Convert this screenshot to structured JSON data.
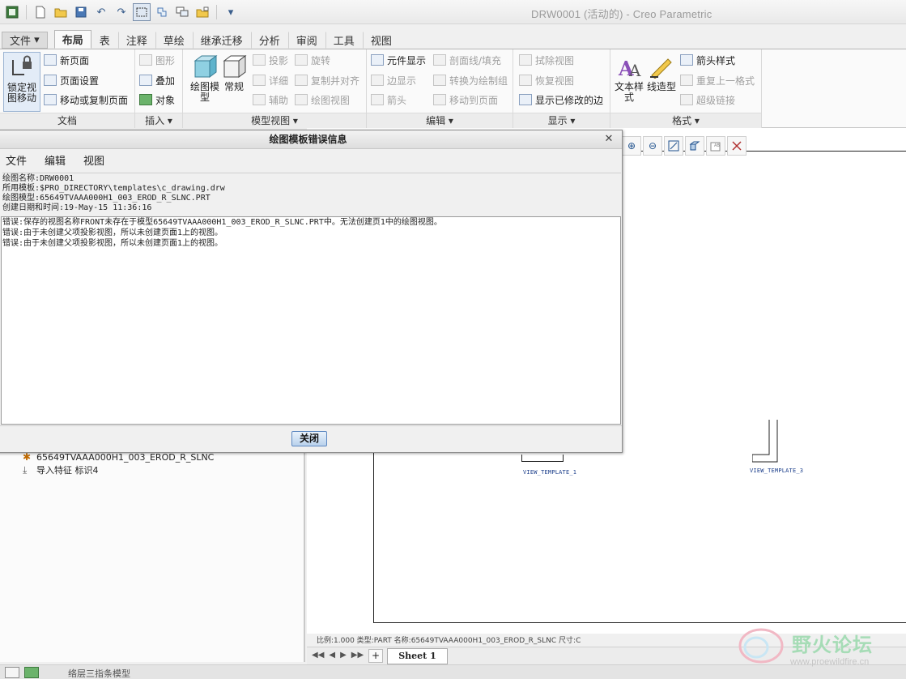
{
  "window": {
    "title": "DRW0001 (活动的) - Creo Parametric"
  },
  "quick_access": [
    "app-icon",
    "new-icon",
    "open-icon",
    "save-icon",
    "undo-icon",
    "redo-icon",
    "select-box-icon",
    "regenerate-icon",
    "windows-icon",
    "close-window-icon",
    "customize-icon"
  ],
  "tabs": [
    "文件",
    "布局",
    "表",
    "注释",
    "草绘",
    "继承迁移",
    "分析",
    "审阅",
    "工具",
    "视图"
  ],
  "ribbon": {
    "document": {
      "label": "文档",
      "big": "锁定视图移动",
      "items": [
        "新页面",
        "页面设置",
        "移动或复制页面"
      ]
    },
    "insert": {
      "label": "插入",
      "items": [
        "图形",
        "叠加",
        "对象"
      ]
    },
    "model_views": {
      "label": "模型视图",
      "big1": "绘图模型",
      "big2": "常规",
      "items": [
        "投影",
        "详细",
        "辅助",
        "旋转",
        "复制并对齐",
        "绘图视图"
      ]
    },
    "edit": {
      "label": "编辑",
      "items": [
        "元件显示",
        "边显示",
        "箭头",
        "剖面线/填充",
        "转换为绘制组",
        "移动到页面"
      ]
    },
    "display": {
      "label": "显示",
      "items": [
        "拭除视图",
        "恢复视图",
        "显示已修改的边"
      ]
    },
    "format": {
      "label": "格式",
      "big1": "文本样式",
      "big2": "线造型",
      "items": [
        "箭头样式",
        "重复上一格式",
        "超级链接"
      ]
    }
  },
  "dialog": {
    "title": "绘图模板错误信息",
    "menu": [
      "文件",
      "编辑",
      "视图"
    ],
    "info": [
      "绘图名称:DRW0001",
      "所用模板:$PRO_DIRECTORY\\templates\\c_drawing.drw",
      "绘图模型:65649TVAAA000H1_003_EROD_R_SLNC.PRT",
      "创建日期和时间:19-May-15 11:36:16"
    ],
    "errors": [
      "错误:保存的视图名称FRONT未存在于模型65649TVAAA000H1_003_EROD_R_SLNC.PRT中。无法创建页1中的绘图视图。",
      "错误:由于未创建父项投影视图，所以未创建页面1上的视图。",
      "错误:由于未创建父项投影视图，所以未创建页面1上的视图。"
    ],
    "close_label": "关闭"
  },
  "tree": {
    "items": [
      "65649TVAAA000H1_003_EROD_R_SLNC",
      "导入特征 标识4"
    ]
  },
  "drawing": {
    "view_labels": [
      "VIEW_TEMPLATE_1",
      "VIEW_TEMPLATE_3"
    ],
    "status": "比例:1.000    类型:PART    名称:65649TVAAA000H1_003_EROD_R_SLNC    尺寸:C",
    "sheet_tab": "Sheet 1"
  },
  "statusbar": {
    "text": "络层三指条模型"
  },
  "watermark": {
    "text": "野火论坛",
    "url": "www.proewildfire.cn"
  },
  "colors": {
    "accent": "#5d88c1",
    "view_label": "#1a3d8a",
    "watermark": "#a6dcb6"
  }
}
